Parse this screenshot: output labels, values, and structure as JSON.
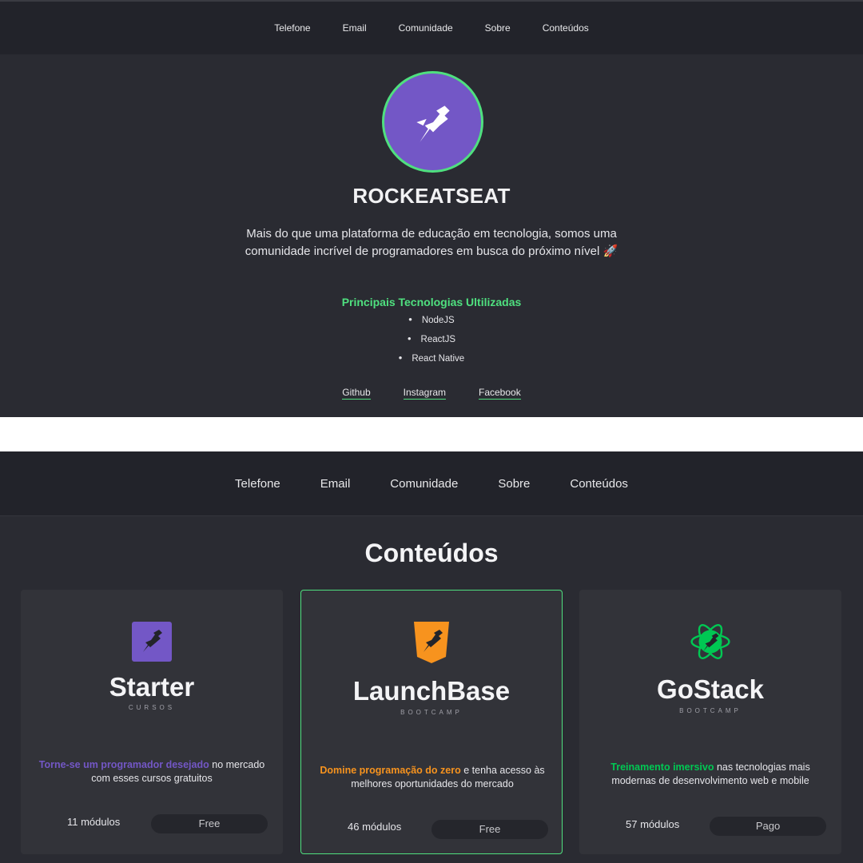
{
  "profile_page": {
    "nav": [
      "Telefone",
      "Email",
      "Comunidade",
      "Sobre",
      "Conteúdos"
    ],
    "brand": "ROCKEATSEAT",
    "description": "Mais do que uma plataforma de educação em tecnologia, somos uma comunidade incrível de programadores em busca do próximo nível 🚀",
    "tech_title": "Principais Tecnologias Ultilizadas",
    "technologies": [
      "NodeJS",
      "ReactJS",
      "React Native"
    ],
    "social_links": [
      "Github",
      "Instagram",
      "Facebook"
    ],
    "colors": {
      "accent": "#4fe07f",
      "avatar_bg": "#7357c6",
      "background": "#2a2b32"
    }
  },
  "contents_page": {
    "nav": [
      "Telefone",
      "Email",
      "Comunidade",
      "Sobre",
      "Conteúdos"
    ],
    "title": "Conteúdos",
    "cards": [
      {
        "name": "Starter",
        "kind": "CURSOS",
        "highlight": "Torne-se um programador desejado",
        "text": " no mercado com esses cursos gratuitos",
        "modules": "11 módulos",
        "price": "Free",
        "highlight_color": "#7357c6",
        "icon": "rocket-square-icon"
      },
      {
        "name": "LaunchBase",
        "kind": "BOOTCAMP",
        "highlight": "Domine programação do zero",
        "text": " e tenha acesso às melhores oportunidades do mercado",
        "modules": "46 módulos",
        "price": "Free",
        "highlight_color": "#f7931e",
        "icon": "rocket-shield-icon"
      },
      {
        "name": "GoStack",
        "kind": "BOOTCAMP",
        "highlight": "Treinamento imersivo",
        "text": " nas tecnologias mais modernas de desenvolvimento web e mobile",
        "modules": "57 módulos",
        "price": "Pago",
        "highlight_color": "#00c853",
        "icon": "rocket-atom-icon"
      }
    ]
  }
}
